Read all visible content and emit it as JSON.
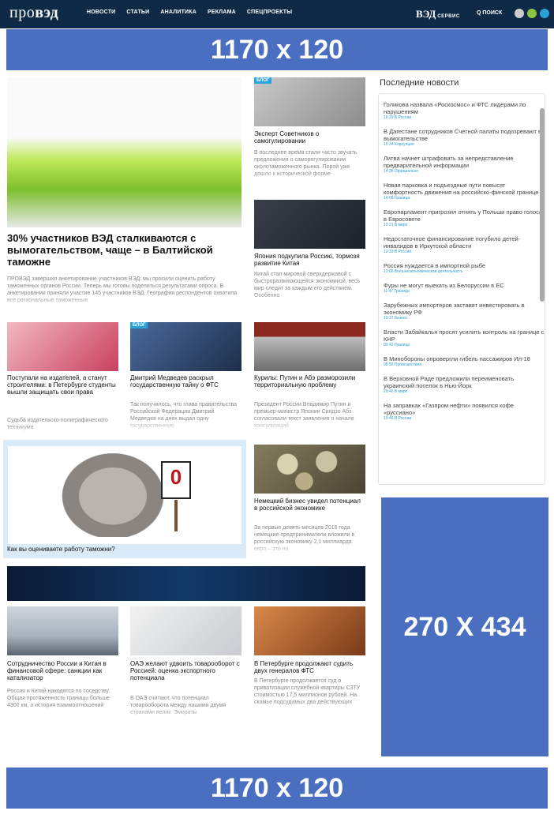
{
  "header": {
    "logo_text": "про",
    "logo_bold": "вэд",
    "nav": [
      "НОВОСТИ",
      "СТАТЬИ",
      "АНАЛИТИКА",
      "РЕКЛАМА",
      "СПЕЦПРОЕКТЫ"
    ],
    "ved_logo": "ВЭД",
    "ved_service": "СЕРВИС",
    "search_label": "Q ПОИСК"
  },
  "ads": {
    "top": "1170 x 120",
    "side": "270 X 434",
    "bottom": "1170 x 120"
  },
  "main_story": {
    "title": "30% участников ВЭД сталкиваются с вымогательством, чаще – в Балтийской таможне",
    "lead": "ПРОВЭД завершил анкетирование участников ВЭД: мы просили оценить работу таможенных органов России. Теперь мы готовы поделиться результатами опроса. В анкетировании приняли участие 145 участников ВЭД. География респондентов охватила все региональные таможенные"
  },
  "side_stories": [
    {
      "badge": "БЛОГ",
      "title": "Эксперт Советников о самогулировании",
      "lead": "В последнее время стали часто звучать предложения о саморегулировании околотаможенного рынка. Порой уже дошло к исторической форме"
    },
    {
      "title": "Япония подкупила Россию, тормозя развитие Китая",
      "lead": "Китай стал мировой сверхдержавой с быстроразвивающейся экономикой, весь мир следит за каждым его действием. Особенно"
    }
  ],
  "row_stories": [
    {
      "title": "Поступали на издателей, а станут строителями: в Петербурге студенты вышли защищать свои права",
      "lead": "Судьба издательско-полиграфического техникума"
    },
    {
      "badge": "БЛОГ",
      "title": "Дмитрий Медведев раскрыл государственную тайну о ФТС",
      "lead": "Так получилось, что глава правительства Российской Федерации Дмитрий Медведев на днях выдал одну государственную"
    },
    {
      "title": "Курилы: Путин и Абэ разморозили территориальную проблему",
      "lead": "Президент России Владимир Путин и премьер-министр Японии Синдзо Абэ согласовали текст заявления о начале консультаций"
    }
  ],
  "poll": {
    "sign_value": "0",
    "question": "Как вы оцениваете работу таможни?"
  },
  "german_story": {
    "title": "Немецкий бизнес увидел потенциал в российской экономике",
    "lead": "За первые девять месяцев 2016 года немецкие предприниматели вложили в российскую экономику 2,1 миллиарда евро – это на"
  },
  "bottom_stories": [
    {
      "title": "Сотрудничество России и Китая в финансовой сфере: санкции как катализатор",
      "lead": "Россия и Китай находятся по соседству. Общая протяженность границы больше 4300 км, а история взаимоотношений"
    },
    {
      "title": "ОАЭ желают удвоить товарооборот с Россией: оценка экспортного потенциала",
      "lead": "В ОАЭ считают, что потенциал товарооборота между нашими двумя странами велик. Эмираты"
    },
    {
      "title": "В Петербурге продолжают судить двух генералов ФТС",
      "lead": "В Петербурге продолжается суд о приватизации служебной квартиры СЗТУ стоимостью 17,5 миллионов рублей. На скамье подсудимых два действующих"
    }
  ],
  "latest_news": {
    "title": "Последние новости",
    "items": [
      {
        "headline": "Голикова назвала «Роскосмос» и ФТС лидерами по нарушениям",
        "meta": "16:29 В России"
      },
      {
        "headline": "В Дагестане сотрудников Счетной палаты подозревают в вымогательстве",
        "meta": "15:34 Коррупция"
      },
      {
        "headline": "Литва начнет штрафовать за непредставление предварительной информации",
        "meta": "14:28 Официально"
      },
      {
        "headline": "Новая парковка и подъездные пути повысят комфортность движения на российско-финской границе",
        "meta": "14:08 Граница"
      },
      {
        "headline": "Европарламент пригрозил отнять у Польши право голоса в Евросовете",
        "meta": "13:21 В мире"
      },
      {
        "headline": "Недостаточное финансирование погубило детей-инвалидов в Иркутской области",
        "meta": "12:33 В России"
      },
      {
        "headline": "Россия нуждается в импортной рыбе",
        "meta": "12:06 Внешнеэкономическая деятельность"
      },
      {
        "headline": "Фуры не могут выехать из Белоруссии в ЕС",
        "meta": "11:47 Граница"
      },
      {
        "headline": "Зарубежных импортеров заставят инвестировать в экономику РФ",
        "meta": "10:37 Бизнес"
      },
      {
        "headline": "Власти Забайкалья просят усилить контроль на границе с КНР",
        "meta": "09:42 Граница"
      },
      {
        "headline": "В Минобороны опровергли гибель пассажиров Ил-18",
        "meta": "08:55 Происшествия"
      },
      {
        "headline": "В Верховной Раде предложили переименовать украинский поселок в Нью-Йорк",
        "meta": "20:46 В мире"
      },
      {
        "headline": "На заправках «Газпром нефти» появился кофе «руссиано»",
        "meta": "19:46 В России"
      }
    ]
  }
}
